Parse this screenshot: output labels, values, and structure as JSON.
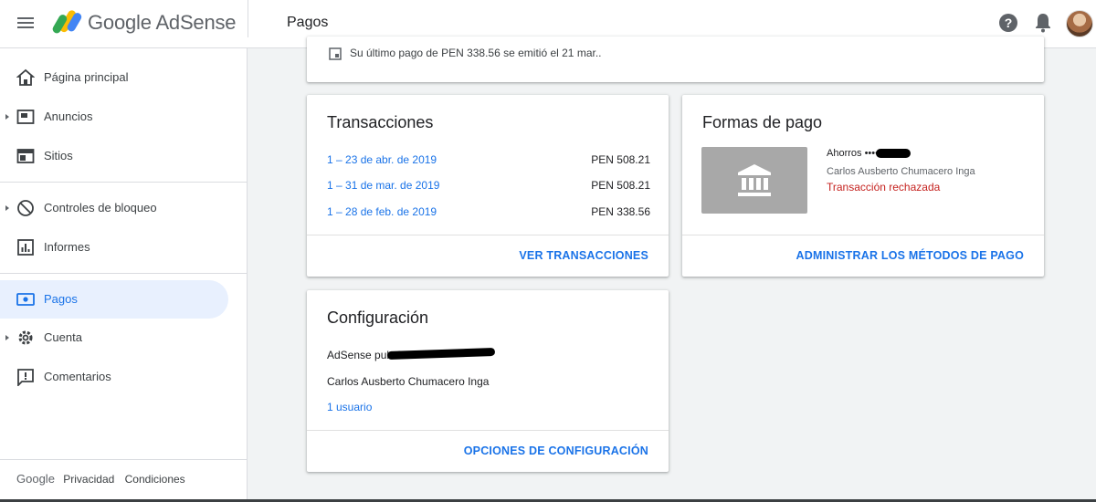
{
  "header": {
    "brand": "Google AdSense",
    "page_title": "Pagos",
    "help_glyph": "?",
    "icons": [
      "menu-icon",
      "adsense-logo",
      "help-icon",
      "notifications-icon",
      "avatar"
    ]
  },
  "sidebar": {
    "items": [
      {
        "label": "Página principal",
        "icon": "home-icon"
      },
      {
        "label": "Anuncios",
        "icon": "ads-icon",
        "expandable": true
      },
      {
        "label": "Sitios",
        "icon": "sites-icon"
      },
      {
        "label": "Controles de bloqueo",
        "icon": "block-icon",
        "expandable": true
      },
      {
        "label": "Informes",
        "icon": "reports-icon"
      },
      {
        "label": "Pagos",
        "icon": "payments-icon",
        "active": true
      },
      {
        "label": "Cuenta",
        "icon": "gear-icon",
        "expandable": true
      },
      {
        "label": "Comentarios",
        "icon": "feedback-icon"
      }
    ],
    "footer": {
      "google": "Google",
      "privacy": "Privacidad",
      "terms": "Condiciones"
    }
  },
  "last_payment": {
    "text": "Su último pago de PEN 338.56 se emitió el 21 mar.."
  },
  "transactions": {
    "title": "Transacciones",
    "rows": [
      {
        "period": "1 – 23 de abr. de 2019",
        "amount": "PEN 508.21"
      },
      {
        "period": "1 – 31 de mar. de 2019",
        "amount": "PEN 508.21"
      },
      {
        "period": "1 – 28 de feb. de 2019",
        "amount": "PEN 338.56"
      }
    ],
    "action": "VER TRANSACCIONES"
  },
  "payment_methods": {
    "title": "Formas de pago",
    "account_label": "Ahorros ••••",
    "holder": "Carlos Ausberto Chumacero Inga",
    "status": "Transacción rechazada",
    "status_color": "#c5221f",
    "action": "ADMINISTRAR LOS MÉTODOS DE PAGO"
  },
  "settings": {
    "title": "Configuración",
    "publisher": "AdSense pub-6",
    "name": "Carlos Ausberto Chumacero Inga",
    "users": "1 usuario",
    "action": "OPCIONES DE CONFIGURACIÓN"
  },
  "colors": {
    "accent": "#1a73e8",
    "text": "#202124",
    "muted": "#5f6368",
    "active_bg": "#e8f0fe",
    "bank_tile": "#a8a8a8"
  }
}
